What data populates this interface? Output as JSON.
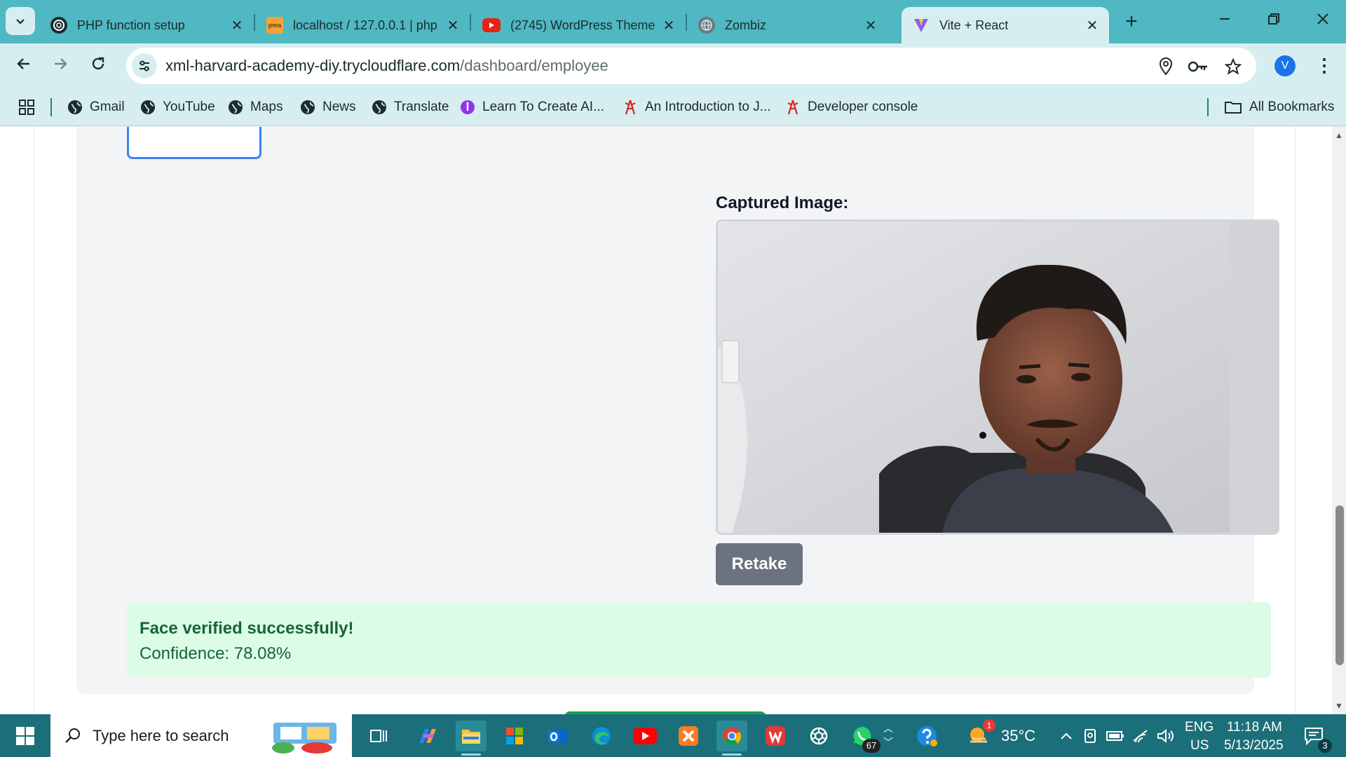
{
  "browser": {
    "tabs": [
      {
        "title": "PHP function setup",
        "favicon": "openai-icon"
      },
      {
        "title": "localhost / 127.0.0.1 | php",
        "favicon": "phpmyadmin-icon"
      },
      {
        "title": "(2745) WordPress Theme",
        "favicon": "youtube-icon"
      },
      {
        "title": "Zombiz",
        "favicon": "globe-icon"
      },
      {
        "title": "Vite + React",
        "favicon": "vite-icon",
        "active": true
      }
    ],
    "close_glyph": "✕",
    "new_tab": "+",
    "url_host": "xml-harvard-academy-diy.trycloudflare.com",
    "url_path": "/dashboard/employee",
    "profile_initial": "V",
    "bookmarks": [
      {
        "label": "Gmail"
      },
      {
        "label": "YouTube"
      },
      {
        "label": "Maps"
      },
      {
        "label": "News"
      },
      {
        "label": "Translate"
      },
      {
        "label": "Learn To Create AI..."
      },
      {
        "label": "An Introduction to J..."
      },
      {
        "label": "Developer console"
      }
    ],
    "all_bookmarks": "All Bookmarks"
  },
  "page": {
    "captured_label": "Captured Image:",
    "retake_label": "Retake",
    "result_title": "Face verified successfully!",
    "result_confidence": "Confidence: 78.08%"
  },
  "taskbar": {
    "search_placeholder": "Type here to search",
    "whatsapp_badge": "67",
    "temperature": "35°C",
    "weather_badge": "1",
    "lang_top": "ENG",
    "lang_bottom": "US",
    "time": "11:18 AM",
    "date": "5/13/2025",
    "notification_count": "3"
  },
  "colors": {
    "tab_strip": "#4fb8c2",
    "toolbar": "#d7eef1",
    "success_bg": "#dcfce7",
    "success_text": "#166534",
    "retake_bg": "#6b7280",
    "taskbar": "#1b6f7a"
  }
}
